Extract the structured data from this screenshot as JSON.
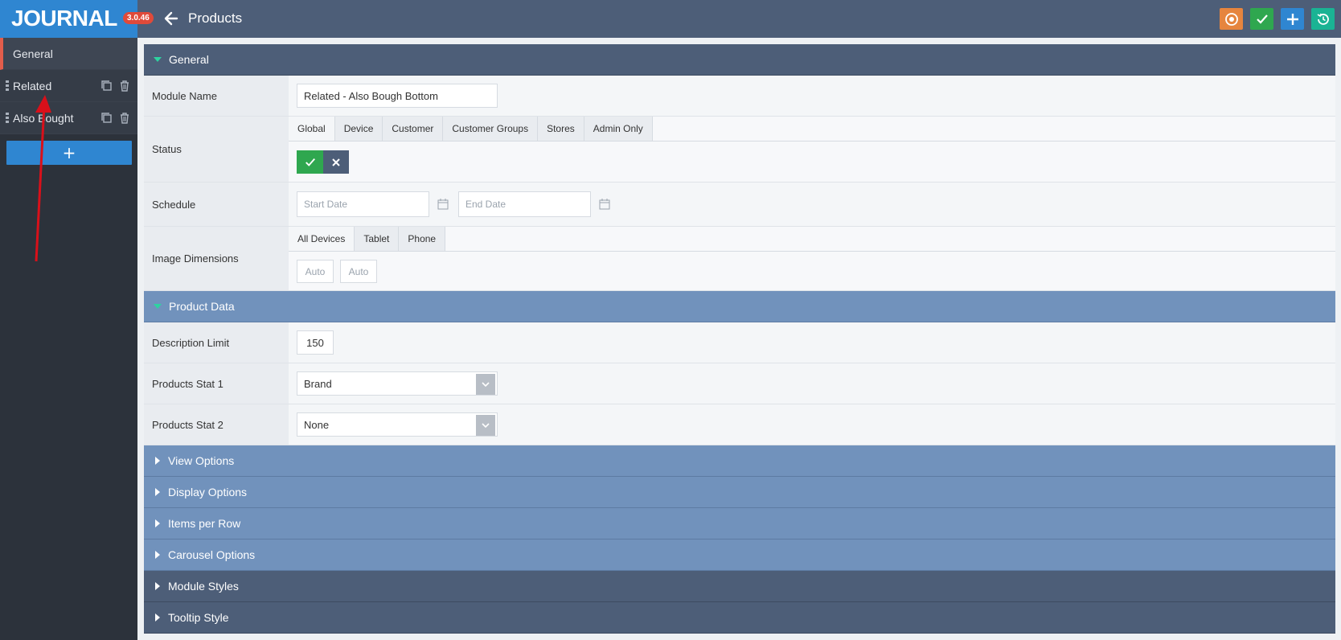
{
  "header": {
    "logo": "JOURNAL",
    "version": "3.0.46",
    "title": "Products",
    "buttons": [
      {
        "name": "refresh-settings-button",
        "color": "#e6853e"
      },
      {
        "name": "save-button",
        "color": "#2fa74f"
      },
      {
        "name": "add-button",
        "color": "#2f86d1"
      },
      {
        "name": "history-button",
        "color": "#1ab394"
      }
    ]
  },
  "sidebar": {
    "items": [
      {
        "label": "General",
        "active": true
      },
      {
        "label": "Related"
      },
      {
        "label": "Also Bought"
      }
    ],
    "add_label": "+"
  },
  "general": {
    "title": "General",
    "module_name_label": "Module Name",
    "module_name_value": "Related - Also Bough Bottom",
    "status_label": "Status",
    "status_tabs": [
      "Global",
      "Device",
      "Customer",
      "Customer Groups",
      "Stores",
      "Admin Only"
    ],
    "schedule_label": "Schedule",
    "start_placeholder": "Start Date",
    "end_placeholder": "End Date",
    "image_dim_label": "Image Dimensions",
    "image_tabs": [
      "All Devices",
      "Tablet",
      "Phone"
    ],
    "width_placeholder": "Auto",
    "height_placeholder": "Auto"
  },
  "product_data": {
    "title": "Product Data",
    "desc_limit_label": "Description Limit",
    "desc_limit_value": "150",
    "stat1_label": "Products Stat 1",
    "stat1_value": "Brand",
    "stat2_label": "Products Stat 2",
    "stat2_value": "None"
  },
  "collapsed_sections": [
    {
      "title": "View Options",
      "style": "light"
    },
    {
      "title": "Display Options",
      "style": "light"
    },
    {
      "title": "Items per Row",
      "style": "light"
    },
    {
      "title": "Carousel Options",
      "style": "light"
    },
    {
      "title": "Module Styles",
      "style": "dark"
    },
    {
      "title": "Tooltip Style",
      "style": "dark"
    }
  ]
}
